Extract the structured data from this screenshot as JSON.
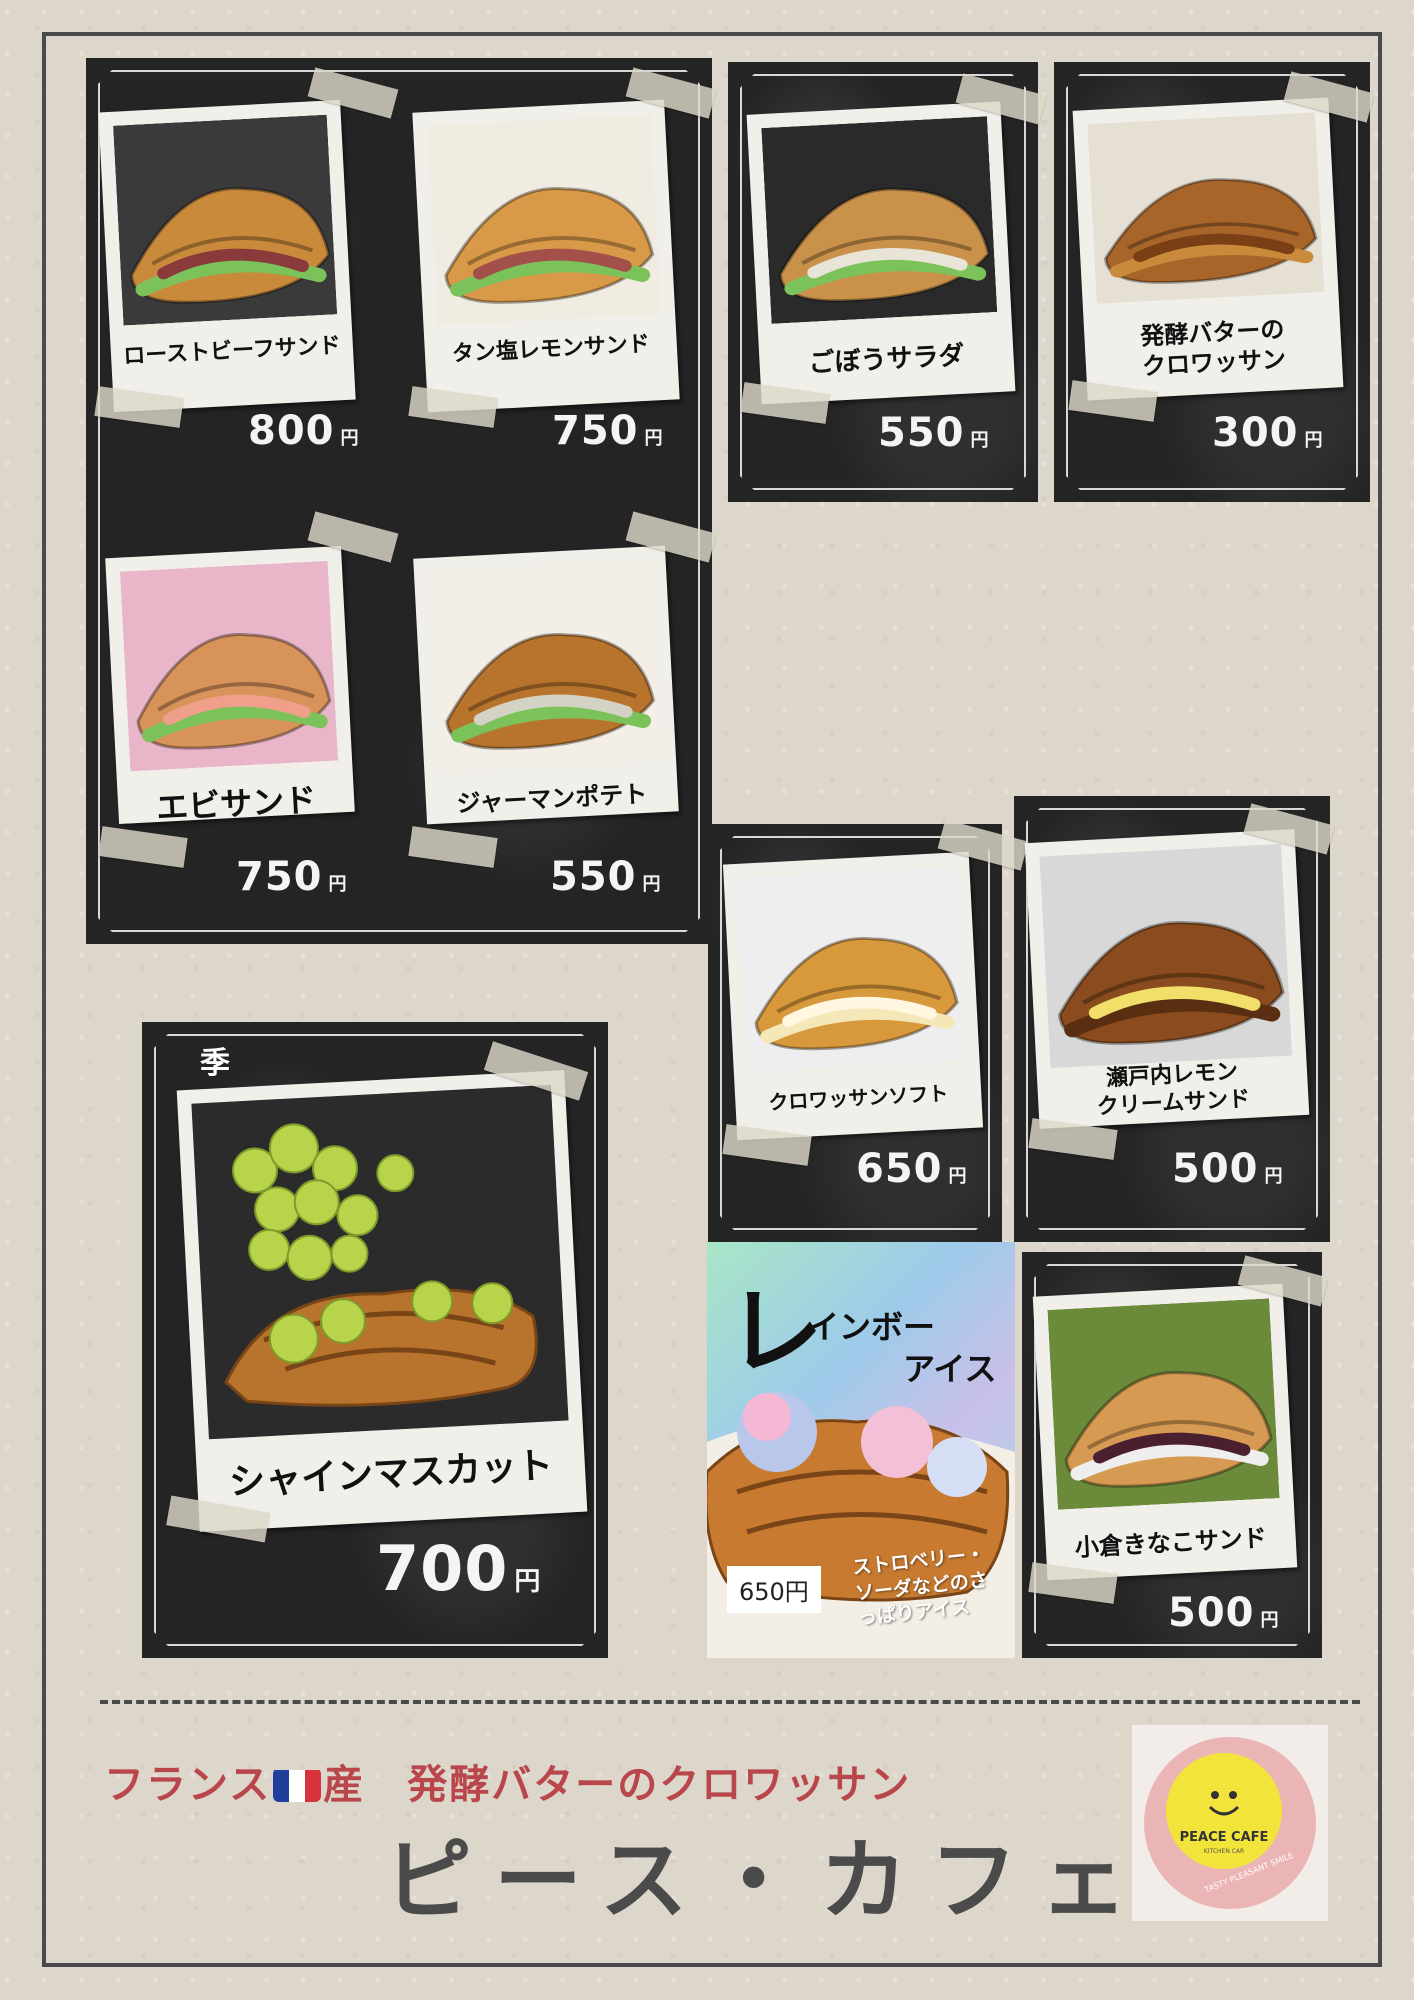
{
  "items": [
    {
      "name": "ローストビーフサンド",
      "price": "800",
      "yen": "円"
    },
    {
      "name": "タン塩レモンサンド",
      "price": "750",
      "yen": "円"
    },
    {
      "name": "ごぼうサラダ",
      "price": "550",
      "yen": "円"
    },
    {
      "name": "発酵バターの\nクロワッサン",
      "price": "300",
      "yen": "円"
    },
    {
      "name": "エビサンド",
      "price": "750",
      "yen": "円"
    },
    {
      "name": "ジャーマンポテト",
      "price": "550",
      "yen": "円"
    },
    {
      "name": "クロワッサンソフト",
      "price": "650",
      "yen": "円"
    },
    {
      "name": "瀬戸内レモン\nクリームサンド",
      "price": "500",
      "yen": "円"
    },
    {
      "name": "小倉きなこサンド",
      "price": "500",
      "yen": "円"
    }
  ],
  "seasonal": {
    "label": "季節限定",
    "name": "シャインマスカット",
    "price": "700",
    "yen": "円"
  },
  "rainbow": {
    "big": "レ",
    "line1": "インボー",
    "line2": "アイス",
    "price": "650円",
    "desc": "ストロベリー・ソーダなどのさっぱりアイス"
  },
  "footer": {
    "tagline_pre": "フランス",
    "tagline_post": "産　発酵バターのクロワッサン",
    "shop": "ピース・カフェ"
  },
  "logo": {
    "brand": "PEACE CAFE",
    "sub": "KITCHEN CAR",
    "slogan": "TASTY PLEASANT SMILE"
  },
  "colors": {
    "tagline": "#b9464a",
    "shop": "#4b4b4b",
    "board": "#242424",
    "logo_yellow": "#f2e43a",
    "logo_pink": "#e8a0a4"
  }
}
